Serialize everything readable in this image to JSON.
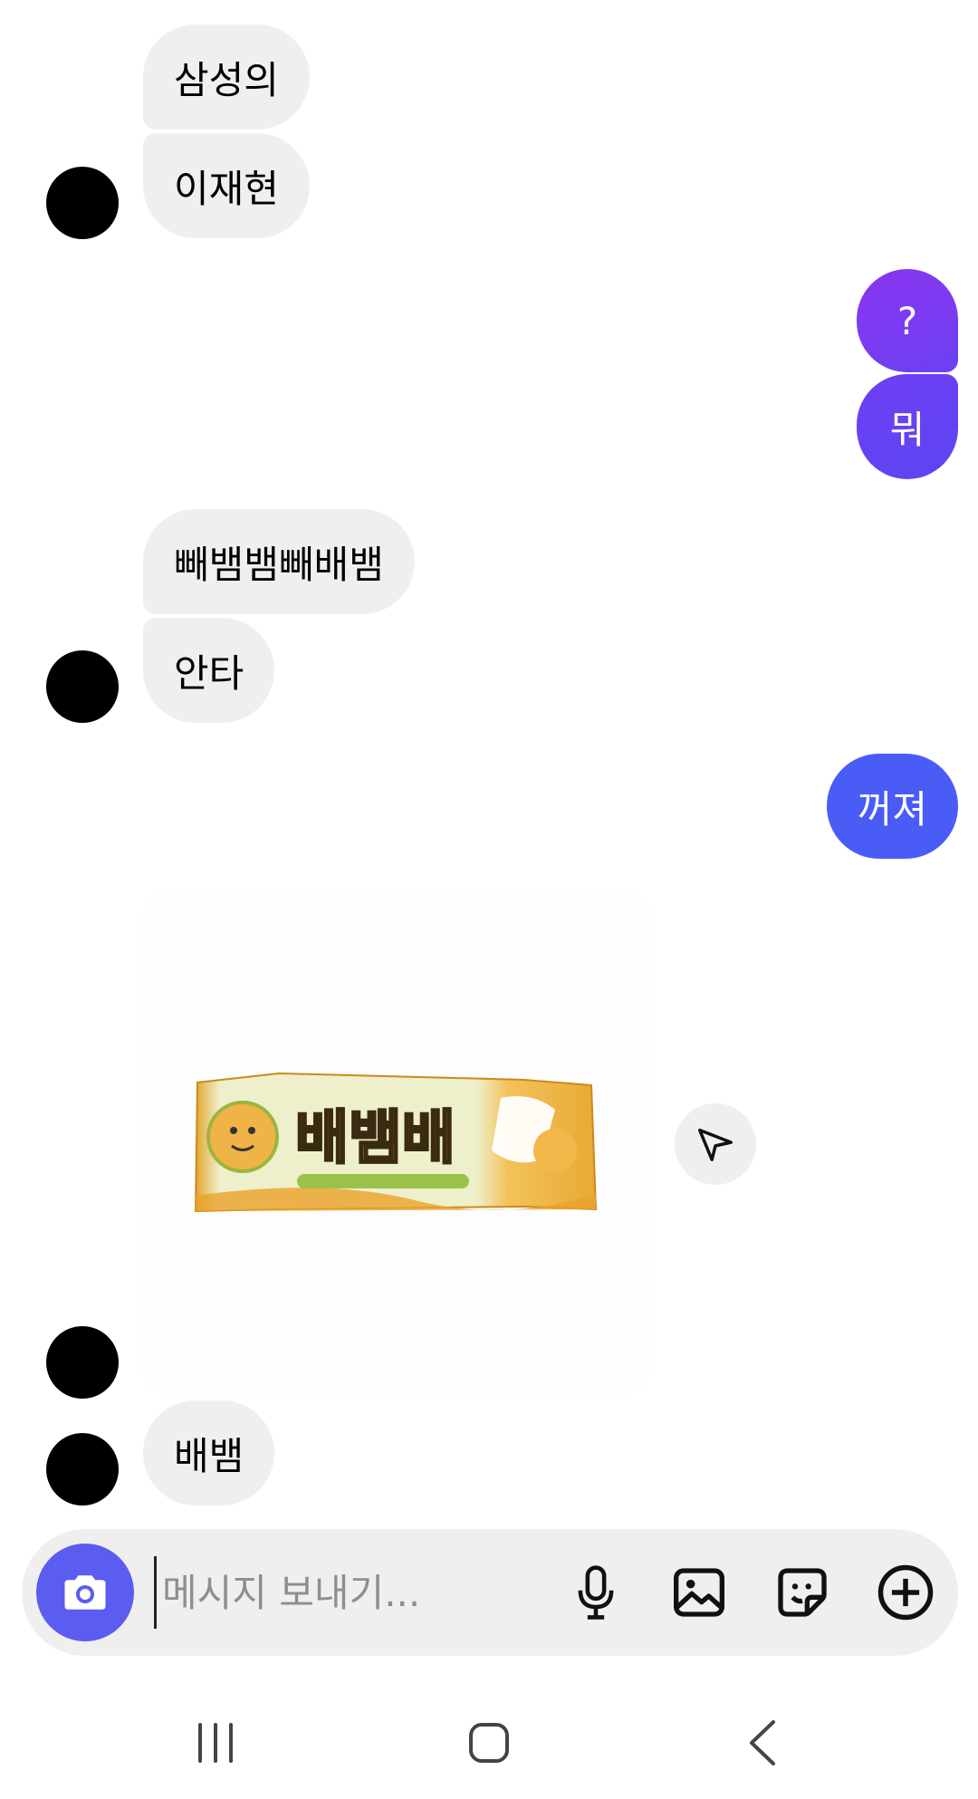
{
  "conversation": {
    "messages": [
      {
        "sender": "other",
        "text": "삼성의"
      },
      {
        "sender": "other",
        "text": "이재현"
      },
      {
        "sender": "me",
        "text": "?"
      },
      {
        "sender": "me",
        "text": "뭐"
      },
      {
        "sender": "other",
        "text": "빼뱀뱀빼배뱀"
      },
      {
        "sender": "other",
        "text": "안타"
      },
      {
        "sender": "me",
        "text": "꺼져"
      },
      {
        "sender": "other",
        "type": "photo",
        "image_text": "배뱀배"
      },
      {
        "sender": "other",
        "text": "배뱀"
      }
    ]
  },
  "composer": {
    "placeholder": "메시지 보내기...",
    "value": "",
    "icons": [
      "camera-icon",
      "microphone-icon",
      "gallery-icon",
      "sticker-icon",
      "plus-icon"
    ]
  },
  "navigation": {
    "icons": [
      "recent-apps-icon",
      "home-icon",
      "back-icon"
    ]
  },
  "colors": {
    "incoming_bubble": "#efefef",
    "outgoing_purple": "#7b3df5",
    "outgoing_violet": "#6a3ff2",
    "outgoing_blue": "#4a5cf6",
    "camera_button": "#5b5cf0",
    "avatar": "#000000"
  }
}
